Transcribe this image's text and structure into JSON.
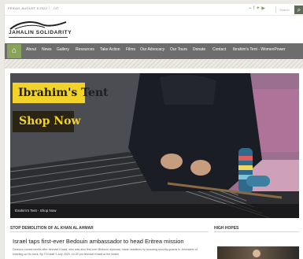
{
  "topbar": {
    "date": "FRIDAY, AUGUST 5 2022",
    "separator": "|",
    "top_link": "לנח",
    "search_label": "Search",
    "social_icons": [
      "rss-icon",
      "facebook-icon",
      "twitter-icon",
      "youtube-icon"
    ]
  },
  "logo": {
    "text": "JAHALIN SOLIDARITY"
  },
  "nav": {
    "items": [
      {
        "label": "About"
      },
      {
        "label": "News"
      },
      {
        "label": "Gallery"
      },
      {
        "label": "Resources"
      },
      {
        "label": "Take Action"
      },
      {
        "label": "Films"
      },
      {
        "label": "Our Advocacy"
      },
      {
        "label": "Our Tours"
      },
      {
        "label": "Donate"
      },
      {
        "label": "Contact"
      },
      {
        "label": "Ibrahim's Tent - WomenPower"
      }
    ]
  },
  "hero": {
    "title": "Ibrahim's Tent",
    "cta": "Shop Now",
    "caption": "Ibrahim's Tent - Shop Now"
  },
  "sections": {
    "main_heading": "STOP DEMOLITION OF AL KHAN AL AHMAR",
    "side_heading": "HIGH HOPES"
  },
  "story": {
    "title": "Israel taps first-ever Bedouin ambassador to head Eritrea mission",
    "excerpt": "Decision comes weeks after Ishmael Khaldi, who was also first-ever Bedouin diplomat, made headlines by accusing security guards in Jerusalem of kneeling on his neck. By TOI staff 3 July 2020, 10:30 pm Ishmael Khaldi at the Israeli"
  },
  "colors": {
    "nav_bg": "#6d6d6d",
    "home_green": "#8aa35a",
    "hero_yellow": "#f1d32a",
    "hero_dark": "#2a2414"
  }
}
